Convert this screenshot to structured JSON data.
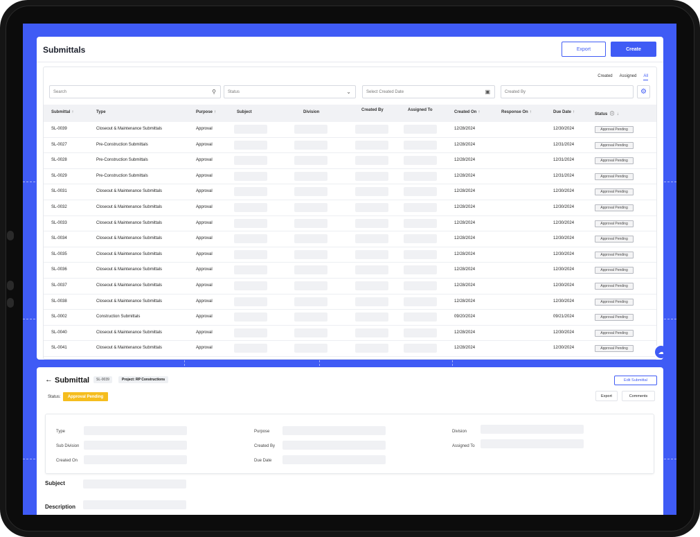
{
  "list": {
    "title": "Submittals",
    "export_label": "Export",
    "create_label": "Create",
    "scope_tabs": [
      {
        "label": "Created",
        "active": false
      },
      {
        "label": "Assigned",
        "active": false
      },
      {
        "label": "All",
        "active": true
      }
    ],
    "filters": {
      "search_placeholder": "Search",
      "status_placeholder": "Status",
      "date_placeholder": "Select Created Date",
      "created_by_placeholder": "Created By"
    },
    "columns": [
      "Submittal",
      "Type",
      "Purpose",
      "Subject",
      "Division",
      "Created By",
      "Assigned To",
      "Created On",
      "Response On",
      "Due Date",
      "Status"
    ],
    "rows": [
      {
        "id": "SL-0039",
        "type": "Closeout & Maintenance Submittals",
        "purpose": "Approval",
        "created_on": "12/28/2024",
        "due_date": "12/30/2024",
        "status": "Approval Pending"
      },
      {
        "id": "SL-0027",
        "type": "Pre-Construction Submittals",
        "purpose": "Approval",
        "created_on": "12/28/2024",
        "due_date": "12/31/2024",
        "status": "Approval Pending"
      },
      {
        "id": "SL-0028",
        "type": "Pre-Construction Submittals",
        "purpose": "Approval",
        "created_on": "12/28/2024",
        "due_date": "12/31/2024",
        "status": "Approval Pending"
      },
      {
        "id": "SL-0029",
        "type": "Pre-Construction Submittals",
        "purpose": "Approval",
        "created_on": "12/28/2024",
        "due_date": "12/31/2024",
        "status": "Approval Pending"
      },
      {
        "id": "SL-0031",
        "type": "Closeout & Maintenance Submittals",
        "purpose": "Approval",
        "created_on": "12/28/2024",
        "due_date": "12/30/2024",
        "status": "Approval Pending"
      },
      {
        "id": "SL-0032",
        "type": "Closeout & Maintenance Submittals",
        "purpose": "Approval",
        "created_on": "12/28/2024",
        "due_date": "12/30/2024",
        "status": "Approval Pending"
      },
      {
        "id": "SL-0033",
        "type": "Closeout & Maintenance Submittals",
        "purpose": "Approval",
        "created_on": "12/28/2024",
        "due_date": "12/30/2024",
        "status": "Approval Pending"
      },
      {
        "id": "SL-0034",
        "type": "Closeout & Maintenance Submittals",
        "purpose": "Approval",
        "created_on": "12/28/2024",
        "due_date": "12/30/2024",
        "status": "Approval Pending"
      },
      {
        "id": "SL-0035",
        "type": "Closeout & Maintenance Submittals",
        "purpose": "Approval",
        "created_on": "12/28/2024",
        "due_date": "12/30/2024",
        "status": "Approval Pending"
      },
      {
        "id": "SL-0036",
        "type": "Closeout & Maintenance Submittals",
        "purpose": "Approval",
        "created_on": "12/28/2024",
        "due_date": "12/30/2024",
        "status": "Approval Pending"
      },
      {
        "id": "SL-0037",
        "type": "Closeout & Maintenance Submittals",
        "purpose": "Approval",
        "created_on": "12/28/2024",
        "due_date": "12/30/2024",
        "status": "Approval Pending"
      },
      {
        "id": "SL-0038",
        "type": "Closeout & Maintenance Submittals",
        "purpose": "Approval",
        "created_on": "12/28/2024",
        "due_date": "12/30/2024",
        "status": "Approval Pending"
      },
      {
        "id": "SL-0002",
        "type": "Construction Submittals",
        "purpose": "Approval",
        "created_on": "09/20/2024",
        "due_date": "09/21/2024",
        "status": "Approval Pending"
      },
      {
        "id": "SL-0040",
        "type": "Closeout & Maintenance Submittals",
        "purpose": "Approval",
        "created_on": "12/28/2024",
        "due_date": "12/30/2024",
        "status": "Approval Pending"
      },
      {
        "id": "SL-0041",
        "type": "Closeout & Maintenance Submittals",
        "purpose": "Approval",
        "created_on": "12/28/2024",
        "due_date": "12/30/2024",
        "status": "Approval Pending"
      }
    ]
  },
  "detail": {
    "title": "Submittal",
    "id_chip": "SL-0039",
    "project_label": "Project:",
    "project_name": "RP Constructions",
    "edit_label": "Edit Submittal",
    "status_label": "Status:",
    "status_value": "Approval Pending",
    "export_label": "Export",
    "comments_label": "Comments",
    "fields": {
      "type": "Type",
      "purpose": "Purpose",
      "division": "Division",
      "sub_division": "Sub Division",
      "created_by": "Created By",
      "assigned_to": "Assigned To",
      "created_on": "Created On",
      "due_date": "Due Date"
    },
    "subject_label": "Subject",
    "description_label": "Description"
  },
  "colors": {
    "accent": "#3f5bf5",
    "status_pending": "#f5bd1e"
  }
}
